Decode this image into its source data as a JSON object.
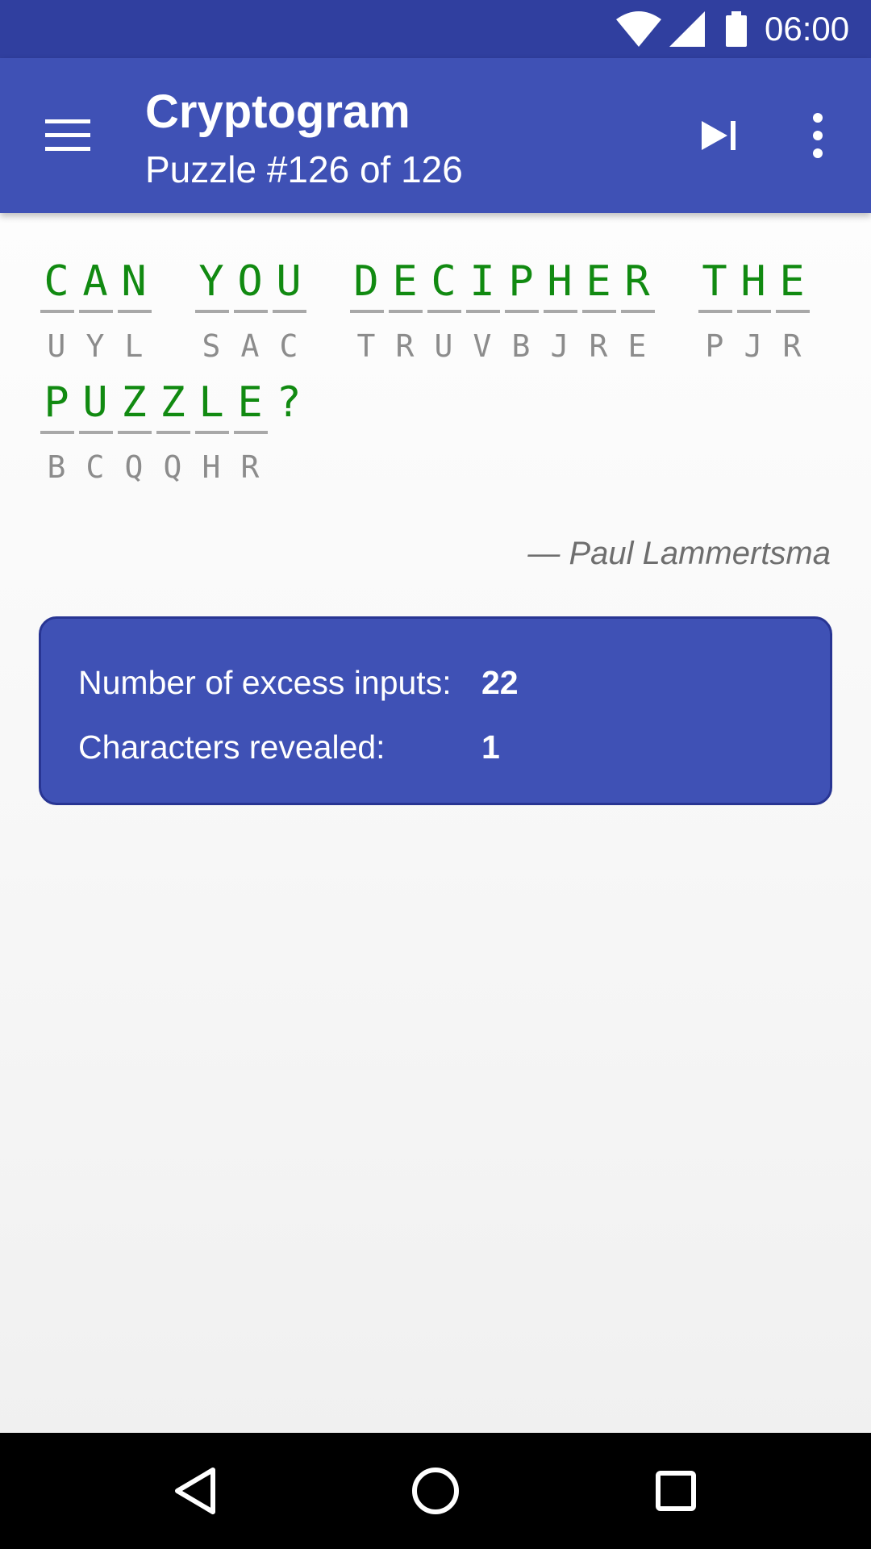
{
  "status_bar": {
    "time": "06:00"
  },
  "app_bar": {
    "title": "Cryptogram",
    "subtitle": "Puzzle #126 of 126"
  },
  "puzzle": {
    "lines": [
      [
        {
          "plain": "C",
          "code": "U"
        },
        {
          "plain": "A",
          "code": "Y"
        },
        {
          "plain": "N",
          "code": "L"
        },
        {
          "plain": " ",
          "code": ""
        },
        {
          "plain": "Y",
          "code": "S"
        },
        {
          "plain": "O",
          "code": "A"
        },
        {
          "plain": "U",
          "code": "C"
        },
        {
          "plain": " ",
          "code": ""
        },
        {
          "plain": "D",
          "code": "T"
        },
        {
          "plain": "E",
          "code": "R"
        },
        {
          "plain": "C",
          "code": "U"
        },
        {
          "plain": "I",
          "code": "V"
        },
        {
          "plain": "P",
          "code": "B"
        },
        {
          "plain": "H",
          "code": "J"
        },
        {
          "plain": "E",
          "code": "R"
        },
        {
          "plain": "R",
          "code": "E"
        },
        {
          "plain": " ",
          "code": ""
        },
        {
          "plain": "T",
          "code": "P"
        },
        {
          "plain": "H",
          "code": "J"
        },
        {
          "plain": "E",
          "code": "R"
        }
      ],
      [
        {
          "plain": "P",
          "code": "B"
        },
        {
          "plain": "U",
          "code": "C"
        },
        {
          "plain": "Z",
          "code": "Q"
        },
        {
          "plain": "Z",
          "code": "Q"
        },
        {
          "plain": "L",
          "code": "H"
        },
        {
          "plain": "E",
          "code": "R"
        },
        {
          "plain": "?",
          "code": "",
          "punct": true
        }
      ]
    ],
    "author": "— Paul Lammertsma"
  },
  "stats": {
    "excess_label": "Number of excess inputs:",
    "excess_value": "22",
    "revealed_label": "Characters revealed:",
    "revealed_value": "1"
  },
  "icons": {
    "wifi": "wifi-icon",
    "signal": "signal-icon",
    "battery": "battery-icon",
    "menu": "hamburger-menu-icon",
    "skip": "skip-next-icon",
    "more": "more-vert-icon",
    "back": "nav-back-icon",
    "home": "nav-home-icon",
    "recents": "nav-recents-icon"
  },
  "colors": {
    "primary": "#3f51b5",
    "primary_dark": "#303f9f",
    "solved_letter": "#118a11",
    "code_letter": "#8c8c8c"
  }
}
